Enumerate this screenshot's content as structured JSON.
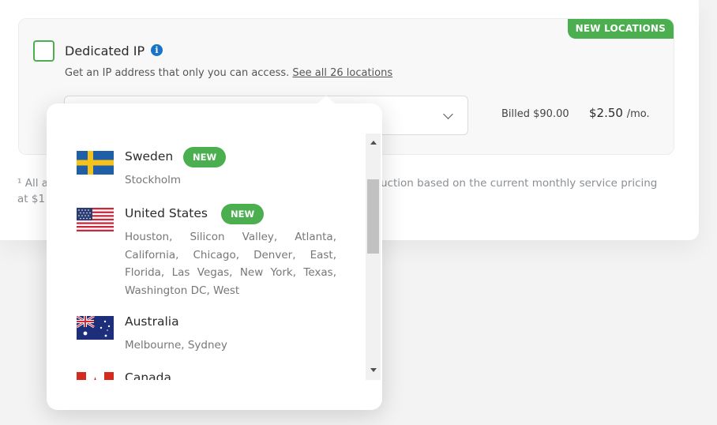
{
  "addon": {
    "badge": "NEW LOCATIONS",
    "title": "Dedicated IP",
    "info_icon": "i",
    "description": "Get an IP address that only you can access.",
    "locations_link": "See all 26 locations",
    "billed": "Billed $90.00",
    "price": "$2.50",
    "price_unit": "/mo."
  },
  "footnote": {
    "left_line1": "¹ All a",
    "left_line2": "at $1",
    "right": "uction based on the current monthly service pricing"
  },
  "locations": [
    {
      "country": "Sweden",
      "badge": "NEW",
      "cities": "Stockholm",
      "flag": "sweden-flag"
    },
    {
      "country": "United States",
      "badge": "NEW",
      "cities": "Houston, Silicon Valley, Atlanta, California, Chicago, Denver, East, Florida, Las Vegas, New York, Texas, Washington DC, West",
      "flag": "usa-flag"
    },
    {
      "country": "Australia",
      "cities": "Melbourne, Sydney",
      "flag": "australia-flag"
    },
    {
      "country": "Canada",
      "flag": "canada-flag"
    }
  ],
  "colors": {
    "accent": "#4bae4f",
    "info": "#1a73c8"
  }
}
